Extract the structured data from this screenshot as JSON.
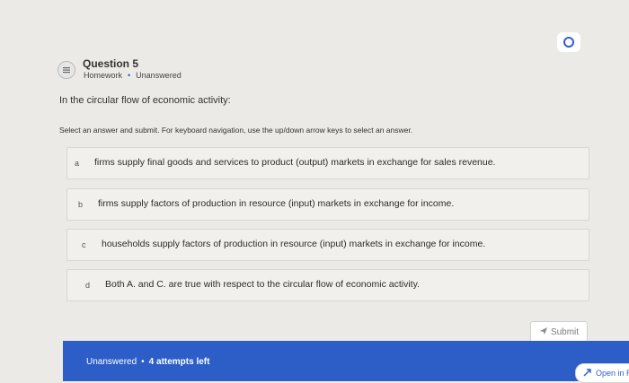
{
  "question": {
    "title": "Question 5",
    "type": "Homework",
    "status": "Unanswered",
    "prompt": "In the circular flow of economic activity:",
    "instructions": "Select an answer and submit. For keyboard navigation, use the up/down arrow keys to select an answer."
  },
  "choices": [
    {
      "letter": "a",
      "text": "firms supply final goods and services to product (output) markets in exchange for sales revenue."
    },
    {
      "letter": "b",
      "text": "firms supply factors of production in resource (input) markets in exchange for income."
    },
    {
      "letter": "c",
      "text": "households supply factors of production in resource (input) markets in exchange for income."
    },
    {
      "letter": "d",
      "text": "Both A. and C. are true with respect to the circular flow of economic activity."
    }
  ],
  "footer": {
    "status": "Unanswered",
    "attempts": "4 attempts left",
    "submit_label": "Submit",
    "open_label": "Open in Re"
  },
  "icons": {
    "question": "list-icon",
    "status": "circle-icon",
    "submit": "send-icon",
    "open": "external-link-icon"
  },
  "colors": {
    "accent": "#2d5ec8",
    "background": "#eceae6"
  }
}
